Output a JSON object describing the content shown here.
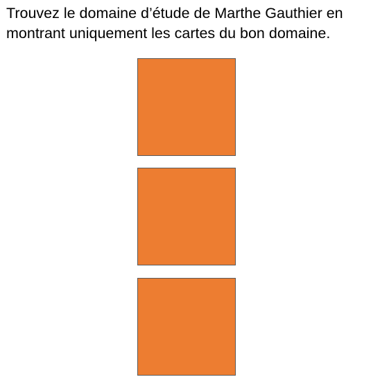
{
  "instruction": {
    "line1": "Trouvez le domaine d’étude de Marthe Gauthier en",
    "line2": "montrant uniquement les cartes du bon domaine."
  },
  "cards": [
    {
      "label": "",
      "color": "#ED7D31"
    },
    {
      "label": "",
      "color": "#ED7D31"
    },
    {
      "label": "",
      "color": "#ED7D31"
    }
  ]
}
